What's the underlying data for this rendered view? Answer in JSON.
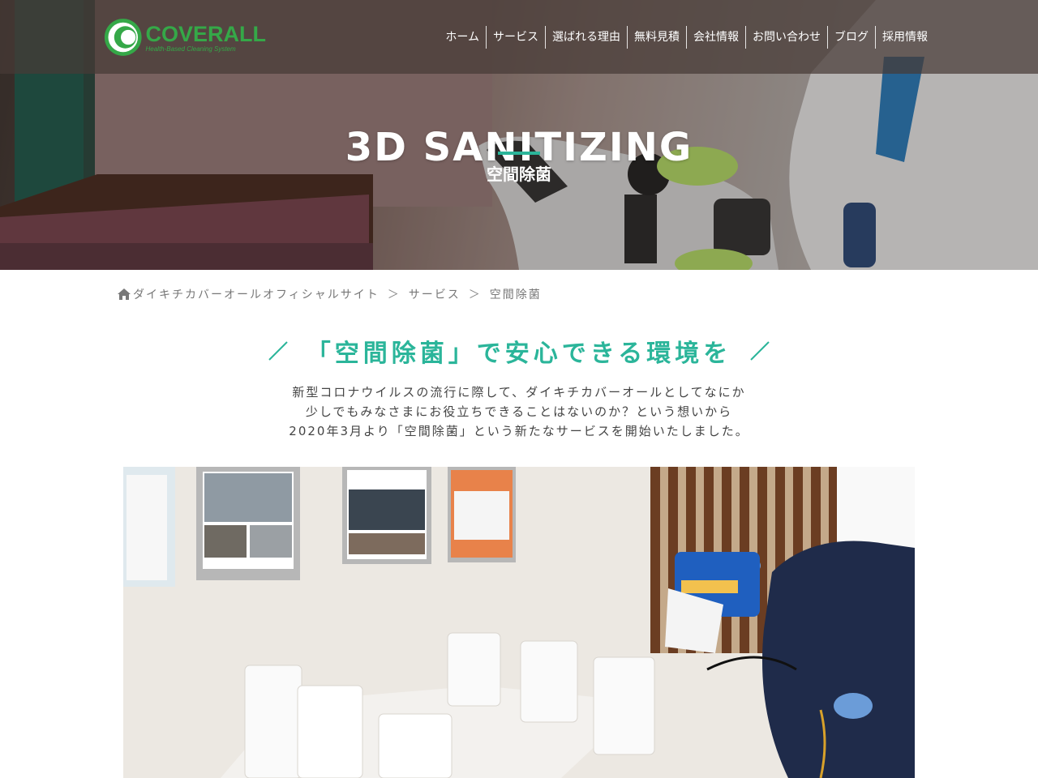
{
  "logo": {
    "name": "COVERALL",
    "tagline": "Health-Based Cleaning System"
  },
  "nav": {
    "items": [
      "ホーム",
      "サービス",
      "選ばれる理由",
      "無料見積",
      "会社情報",
      "お問い合わせ",
      "ブログ",
      "採用情報"
    ]
  },
  "hero": {
    "title": "3D SANITIZING",
    "subtitle": "空間除菌",
    "accent": "#2bb59a"
  },
  "breadcrumb": {
    "items": [
      "ダイキチカバーオールオフィシャルサイト",
      "サービス",
      "空間除菌"
    ],
    "separator": "＞"
  },
  "section": {
    "heading": "「空間除菌」で安心できる環境を",
    "intro": [
      "新型コロナウイルスの流行に際して、ダイキチカバーオールとしてなにか",
      "少しでもみなさまにお役立ちできることはないのか？という想いから",
      "2020年3月より「空間除菌」という新たなサービスを開始いたしました。"
    ]
  },
  "colors": {
    "brand_green": "#35a848",
    "teal": "#2bb59a",
    "text": "#444444"
  }
}
